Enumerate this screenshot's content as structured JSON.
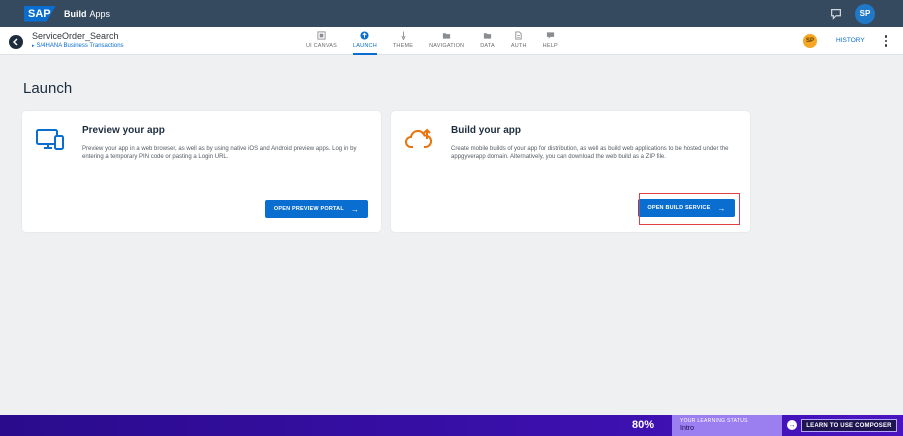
{
  "shell": {
    "logo": "SAP",
    "product_bold": "Build",
    "product_light": "Apps",
    "avatar": "SP"
  },
  "header": {
    "project_name": "ServiceOrder_Search",
    "project_sub": "S/4HANA Business Transactions",
    "tabs": [
      {
        "label": "UI CANVAS",
        "icon": "canvas-icon"
      },
      {
        "label": "LAUNCH",
        "icon": "launch-icon"
      },
      {
        "label": "THEME",
        "icon": "brush-icon"
      },
      {
        "label": "NAVIGATION",
        "icon": "folder-icon"
      },
      {
        "label": "DATA",
        "icon": "folder-icon"
      },
      {
        "label": "AUTH",
        "icon": "document-icon"
      },
      {
        "label": "HELP",
        "icon": "chat-icon"
      }
    ],
    "active_tab": "LAUNCH",
    "badge": "SP",
    "history": "HISTORY"
  },
  "page": {
    "title": "Launch"
  },
  "cards": {
    "preview": {
      "title": "Preview your app",
      "description": "Preview your app in a web browser, as well as by using native iOS and Android preview apps. Log in by entering a temporary PIN code or pasting a Login URL.",
      "button": "OPEN PREVIEW PORTAL"
    },
    "build": {
      "title": "Build your app",
      "description": "Create mobile builds of your app for distribution, as well as build web applications to be hosted under the appgyverapp domain. Alternatively, you can download the web build as a ZIP file.",
      "button": "OPEN BUILD SERVICE"
    }
  },
  "learning": {
    "percent": "80%",
    "status_label": "YOUR LEARNING STATUS",
    "status_value": "Intro",
    "button": "LEARN TO USE COMPOSER"
  },
  "colors": {
    "shell": "#354a5f",
    "accent": "#0a6ed1",
    "highlight": "#e04040",
    "learn_bar": "#3d10b0"
  }
}
